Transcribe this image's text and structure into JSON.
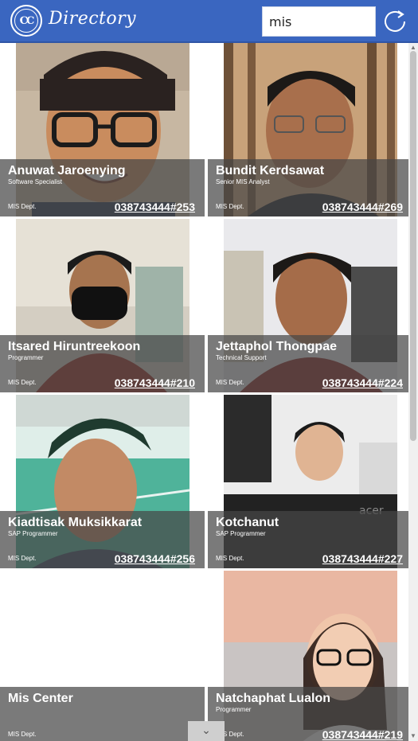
{
  "header": {
    "logo_text": "CC",
    "title": "Directory",
    "search_value": "mis",
    "refresh_icon": "refresh-icon"
  },
  "colors": {
    "header_bg": "#3a66c0",
    "overlay": "rgba(70,70,70,0.72)"
  },
  "people": [
    {
      "name": "Anuwat Jaroenying",
      "role": "Software Specialist",
      "dept": "MIS Dept.",
      "phone": "038743444#253"
    },
    {
      "name": "Bundit Kerdsawat",
      "role": "Senior MIS Analyst",
      "dept": "MIS Dept.",
      "phone": "038743444#269"
    },
    {
      "name": "Itsared Hiruntreekoon",
      "role": "Programmer",
      "dept": "MIS Dept.",
      "phone": "038743444#210"
    },
    {
      "name": "Jettaphol Thongpae",
      "role": "Technical Support",
      "dept": "MIS Dept.",
      "phone": "038743444#224"
    },
    {
      "name": "Kiadtisak Muksikkarat",
      "role": "SAP Programmer",
      "dept": "MIS Dept.",
      "phone": "038743444#256"
    },
    {
      "name": "Kotchanut",
      "role": "SAP Programmer",
      "dept": "MIS Dept.",
      "phone": "038743444#227"
    },
    {
      "name": "Mis Center",
      "role": "",
      "dept": "MIS Dept.",
      "phone": ""
    },
    {
      "name": "Natchaphat Lualon",
      "role": "Programmer",
      "dept": "MIS Dept.",
      "phone": "038743444#219"
    }
  ],
  "footer": {
    "more_icon": "chevron-down-icon",
    "more_glyph": "⌄"
  }
}
